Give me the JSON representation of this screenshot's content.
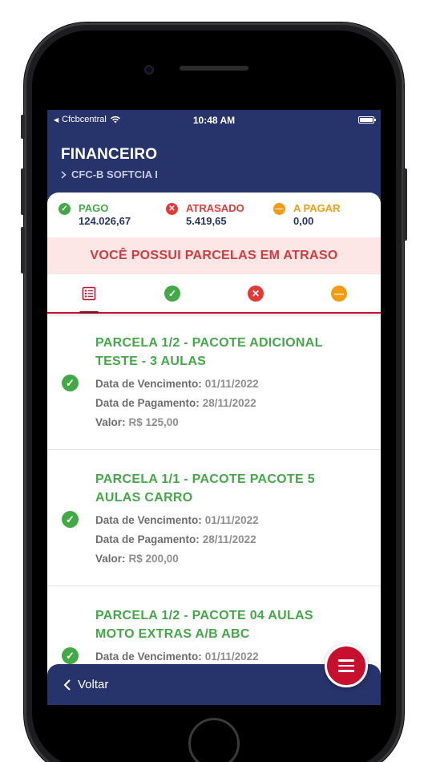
{
  "status_bar": {
    "carrier": "Cfcbcentral",
    "time": "10:48 AM"
  },
  "header": {
    "title": "FINANCEIRO",
    "subtitle": "CFC-B SOFTCIA I"
  },
  "summary": [
    {
      "label": "PAGO",
      "value": "124.026,67",
      "color": "#43a947",
      "icon": "check-icon"
    },
    {
      "label": "ATRASADO",
      "value": "5.419,65",
      "color": "#e53935",
      "icon": "x-icon"
    },
    {
      "label": "A PAGAR",
      "value": "0,00",
      "color": "#f39c12",
      "icon": "minus-icon"
    }
  ],
  "alert": {
    "text": "VOCÊ POSSUI PARCELAS EM ATRASO"
  },
  "tabs": [
    {
      "icon": "list-icon",
      "color": "#c8102e",
      "active": true
    },
    {
      "icon": "check-icon",
      "color": "#43a947"
    },
    {
      "icon": "x-icon",
      "color": "#e53935"
    },
    {
      "icon": "minus-icon",
      "color": "#f39c12"
    }
  ],
  "labels": {
    "due_date": "Data de Vencimento:",
    "pay_date": "Data de Pagamento:",
    "value": "Valor:"
  },
  "installments": [
    {
      "title": "PARCELA 1/2 - PACOTE ADICIONAL TESTE - 3 AULAS",
      "due_date": "01/11/2022",
      "pay_date": "28/11/2022",
      "value": "R$ 125,00"
    },
    {
      "title": "PARCELA 1/1 - PACOTE PACOTE 5 AULAS CARRO",
      "due_date": "01/11/2022",
      "pay_date": "28/11/2022",
      "value": "R$ 200,00"
    },
    {
      "title": "PARCELA 1/2 - PACOTE 04 AULAS MOTO EXTRAS A/B ABC",
      "due_date": "01/11/2022"
    }
  ],
  "footer": {
    "back_label": "Voltar"
  },
  "colors": {
    "primary": "#27346b",
    "accent": "#c8102e",
    "paid": "#43a947",
    "late": "#e53935",
    "pending": "#f39c12"
  }
}
